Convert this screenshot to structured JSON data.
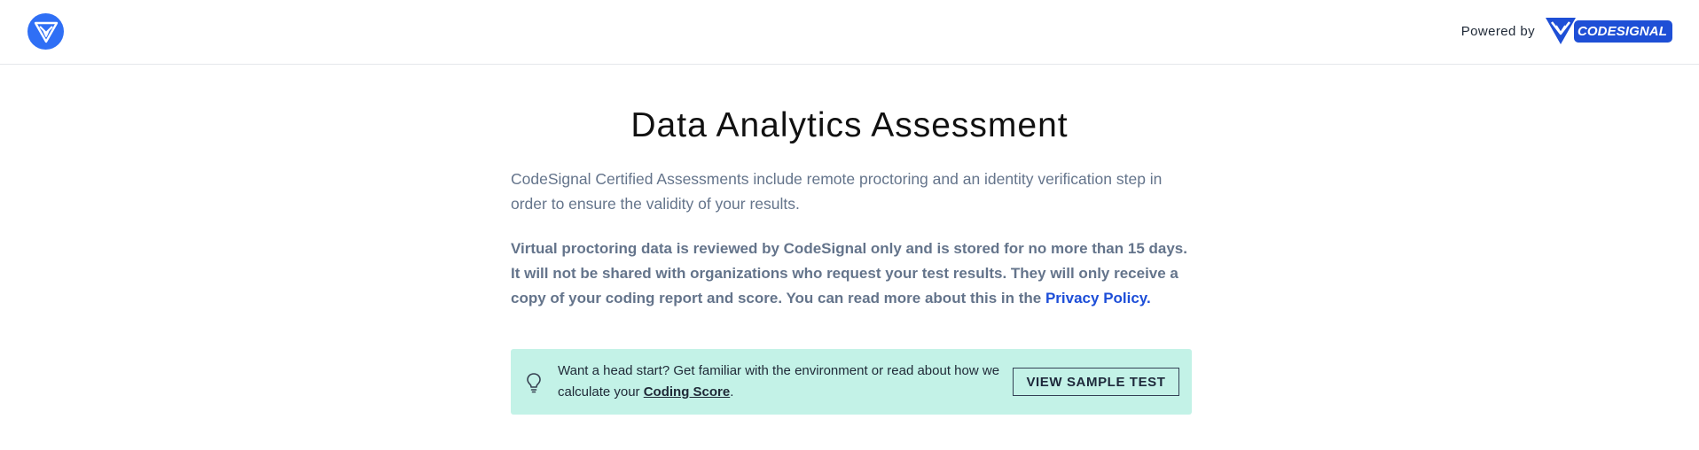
{
  "header": {
    "logo_icon": "shield-logo-icon",
    "powered_by": "Powered by",
    "brand_name": "CODESIGNAL",
    "brand_color": "#1e4fd6",
    "logo_color": "#2f6ff5"
  },
  "main": {
    "title": "Data Analytics Assessment",
    "intro": "CodeSignal Certified Assessments include remote proctoring and an identity verification step in order to ensure the validity of your results.",
    "notice": "Virtual proctoring data is reviewed by CodeSignal only and is stored for no more than 15 days. It will not be shared with organizations who request your test results. They will only receive a copy of your coding report and score. You can read more about this in the ",
    "privacy_link": "Privacy Policy."
  },
  "tip": {
    "icon": "lightbulb-icon",
    "text_before": "Want a head start? Get familiar with the environment or read about how we calculate your ",
    "link": "Coding Score",
    "text_after": ".",
    "button": "VIEW SAMPLE TEST",
    "background": "#c3f2e7"
  }
}
